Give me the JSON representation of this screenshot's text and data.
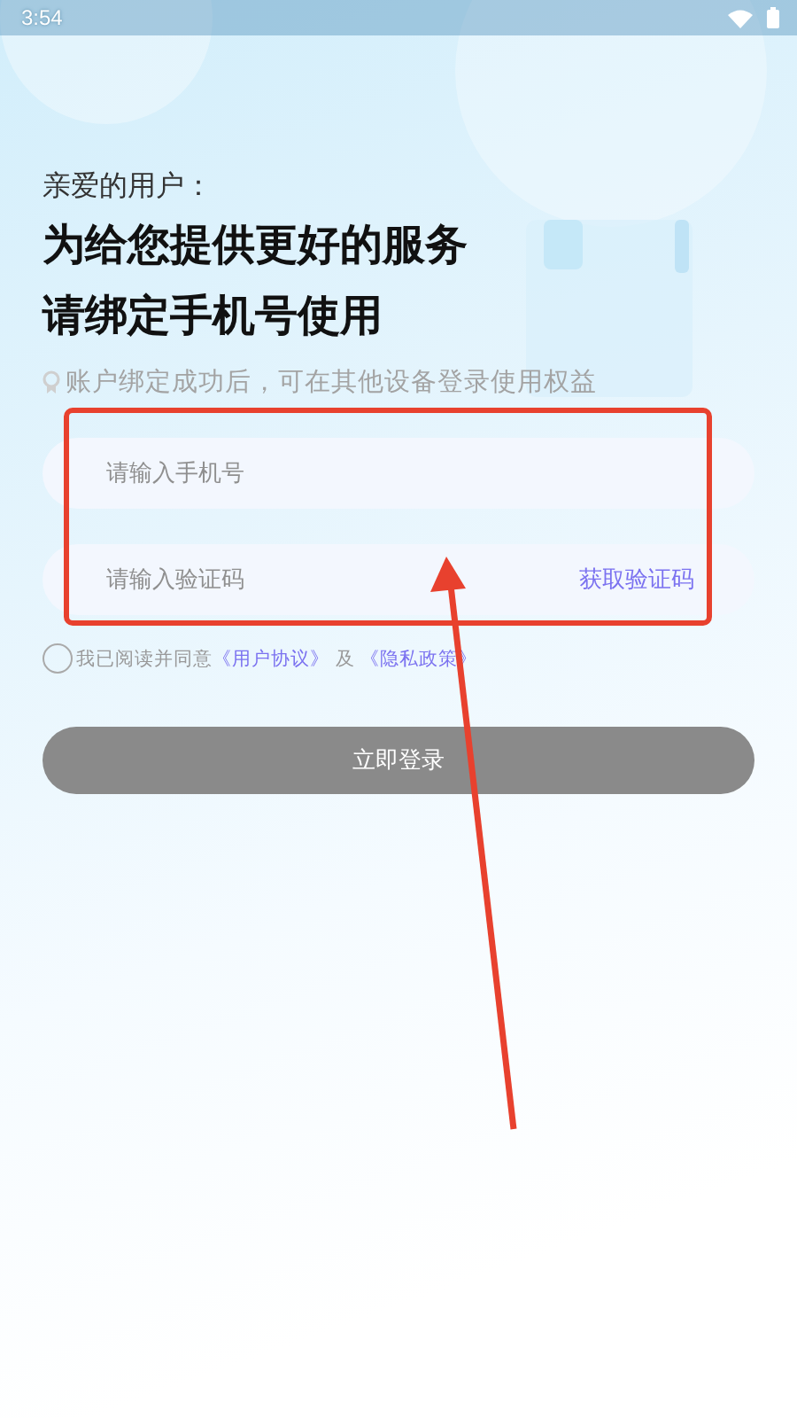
{
  "status_bar": {
    "time": "3:54"
  },
  "greeting": "亲爱的用户：",
  "title_lines": [
    "为给您提供更好的服务",
    "请绑定手机号使用"
  ],
  "hint": "账户绑定成功后，可在其他设备登录使用权益",
  "phone_field": {
    "placeholder": "请输入手机号"
  },
  "code_field": {
    "placeholder": "请输入验证码",
    "action": "获取验证码"
  },
  "agreement": {
    "checked": false,
    "prefix": "我已阅读并同意",
    "link_1": "《用户协议》",
    "middle": "及",
    "link_2": "《隐私政策》"
  },
  "login_button": "立即登录",
  "annotation": {
    "kind": "box-arrow"
  }
}
